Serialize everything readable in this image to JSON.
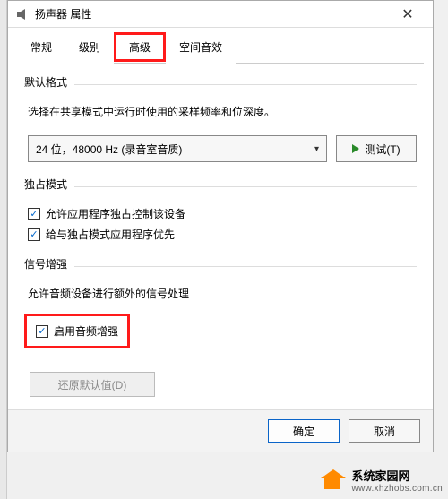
{
  "window": {
    "title": "扬声器 属性",
    "close_glyph": "✕"
  },
  "tabs": {
    "general": "常规",
    "levels": "级别",
    "advanced": "高级",
    "spatial": "空间音效"
  },
  "default_format": {
    "title": "默认格式",
    "desc": "选择在共享模式中运行时使用的采样频率和位深度。",
    "selected": "24 位，48000 Hz (录音室音质)",
    "test_label": "测试(T)"
  },
  "exclusive": {
    "title": "独占模式",
    "opt1": "允许应用程序独占控制该设备",
    "opt1_checked": true,
    "opt2": "给与独占模式应用程序优先",
    "opt2_checked": true
  },
  "enhance": {
    "title": "信号增强",
    "desc": "允许音频设备进行额外的信号处理",
    "opt": "启用音频增强",
    "opt_checked": true
  },
  "restore": "还原默认值(D)",
  "footer": {
    "ok": "确定",
    "cancel": "取消"
  },
  "watermark": {
    "name": "系统家园网",
    "url": "www.xhzhobs.com.cn"
  }
}
